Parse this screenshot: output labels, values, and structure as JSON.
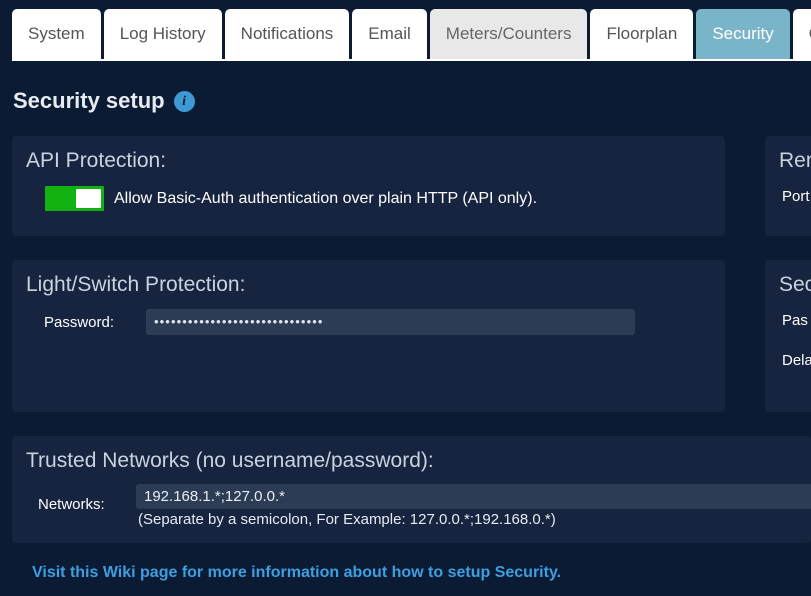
{
  "tabs": [
    {
      "label": "System",
      "state": "normal"
    },
    {
      "label": "Log History",
      "state": "normal"
    },
    {
      "label": "Notifications",
      "state": "normal"
    },
    {
      "label": "Email",
      "state": "normal"
    },
    {
      "label": "Meters/Counters",
      "state": "hovered"
    },
    {
      "label": "Floorplan",
      "state": "normal"
    },
    {
      "label": "Security",
      "state": "active"
    },
    {
      "label": "Ot",
      "state": "normal"
    }
  ],
  "header": {
    "title": "Security setup",
    "info_icon": "info-icon",
    "info_glyph": "i"
  },
  "panels": {
    "api_protection": {
      "title": "API Protection:",
      "toggle_state": "on",
      "toggle_label": "Allow Basic-Auth authentication over plain HTTP (API only)."
    },
    "light_switch_protection": {
      "title": "Light/Switch Protection:",
      "password_label": "Password:",
      "password_value": "••••••••••••••••••••••••••••••"
    },
    "trusted_networks": {
      "title": "Trusted Networks (no username/password):",
      "networks_label": "Networks:",
      "networks_value": "192.168.1.*;127.0.0.*",
      "networks_hint": "(Separate by a semicolon, For Example: 127.0.0.*;192.168.0.*)"
    },
    "remote_clipped": {
      "title": "Rem",
      "field_1": "Port"
    },
    "secure_clipped": {
      "title": "Sec",
      "field_1": "Pas",
      "field_2": "Dela"
    }
  },
  "footer": {
    "wiki_link": "Visit this Wiki page for more information about how to setup Security."
  },
  "colors": {
    "page_background": "#0b1b33",
    "panel_background": "#16243f",
    "active_tab": "#7ab4c9",
    "hovered_tab": "#e8e8e8",
    "toggle_on": "#12b212",
    "link": "#3e9fe0",
    "info_icon": "#3d9ad4",
    "input_background": "#2d3c55"
  }
}
